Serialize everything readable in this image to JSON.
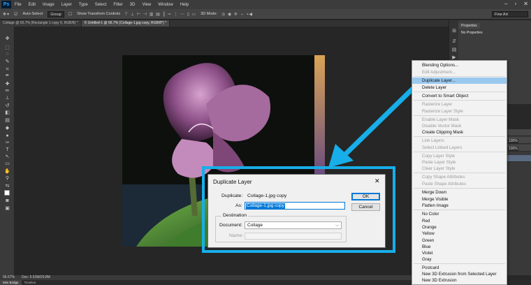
{
  "menubar": {
    "app_logo": "Ps",
    "items": [
      "File",
      "Edit",
      "Image",
      "Layer",
      "Type",
      "Select",
      "Filter",
      "3D",
      "View",
      "Window",
      "Help"
    ]
  },
  "options": {
    "auto_select_label": "Auto-Select:",
    "auto_select_value": "Group",
    "transform_label": "Show Transform Controls",
    "mode_label": "3D Mode:",
    "workspace": "Fine Art"
  },
  "tabs": [
    {
      "label": "Collage @ 66.7% (Rectangle 1 copy 6, RGB/8) *",
      "active": false
    },
    {
      "label": "© Untitled-1 @ 66.7% (Collage-1.jpg copy, RGB/8*) *",
      "active": true
    }
  ],
  "status": {
    "zoom": "66.67%",
    "doc": "Doc: 5.52M/29.8M"
  },
  "bottom_tabs": [
    "Mini Bridge",
    "Timeline"
  ],
  "properties": {
    "tab": "Properties",
    "content": "No Properties"
  },
  "layers": {
    "opacity1": "100%",
    "opacity2": "100%"
  },
  "context_menu": {
    "groups": [
      [
        {
          "label": "Blending Options...",
          "enabled": true
        },
        {
          "label": "Edit Adjustment...",
          "enabled": false
        }
      ],
      [
        {
          "label": "Duplicate Layer...",
          "enabled": true,
          "highlighted": true
        },
        {
          "label": "Delete Layer",
          "enabled": true
        }
      ],
      [
        {
          "label": "Convert to Smart Object",
          "enabled": true
        }
      ],
      [
        {
          "label": "Rasterize Layer",
          "enabled": false
        },
        {
          "label": "Rasterize Layer Style",
          "enabled": false
        }
      ],
      [
        {
          "label": "Enable Layer Mask",
          "enabled": false
        },
        {
          "label": "Disable Vector Mask",
          "enabled": false
        },
        {
          "label": "Create Clipping Mask",
          "enabled": true
        }
      ],
      [
        {
          "label": "Link Layers",
          "enabled": false
        },
        {
          "label": "Select Linked Layers",
          "enabled": false
        }
      ],
      [
        {
          "label": "Copy Layer Style",
          "enabled": false
        },
        {
          "label": "Paste Layer Style",
          "enabled": false
        },
        {
          "label": "Clear Layer Style",
          "enabled": false
        }
      ],
      [
        {
          "label": "Copy Shape Attributes",
          "enabled": false
        },
        {
          "label": "Paste Shape Attributes",
          "enabled": false
        }
      ],
      [
        {
          "label": "Merge Down",
          "enabled": true
        },
        {
          "label": "Merge Visible",
          "enabled": true
        },
        {
          "label": "Flatten Image",
          "enabled": true
        }
      ],
      [
        {
          "label": "No Color",
          "enabled": true
        },
        {
          "label": "Red",
          "enabled": true
        },
        {
          "label": "Orange",
          "enabled": true
        },
        {
          "label": "Yellow",
          "enabled": true
        },
        {
          "label": "Green",
          "enabled": true
        },
        {
          "label": "Blue",
          "enabled": true
        },
        {
          "label": "Violet",
          "enabled": true
        },
        {
          "label": "Gray",
          "enabled": true
        }
      ],
      [
        {
          "label": "Postcard",
          "enabled": true
        },
        {
          "label": "New 3D Extrusion from Selected Layer",
          "enabled": true
        },
        {
          "label": "New 3D Extrusion",
          "enabled": true
        }
      ]
    ]
  },
  "dialog": {
    "title": "Duplicate Layer",
    "close_glyph": "✕",
    "duplicate_label": "Duplicate:",
    "duplicate_value": "Collage-1.jpg copy",
    "as_label": "As:",
    "as_value": "Collage-1.jpg copy",
    "ok": "OK",
    "cancel": "Cancel",
    "destination_label": "Destination",
    "document_label": "Document:",
    "document_value": "Collage",
    "name_label": "Name:"
  },
  "colors": {
    "accent_arrow": "#17aee9",
    "highlight": "#99c9ef"
  }
}
